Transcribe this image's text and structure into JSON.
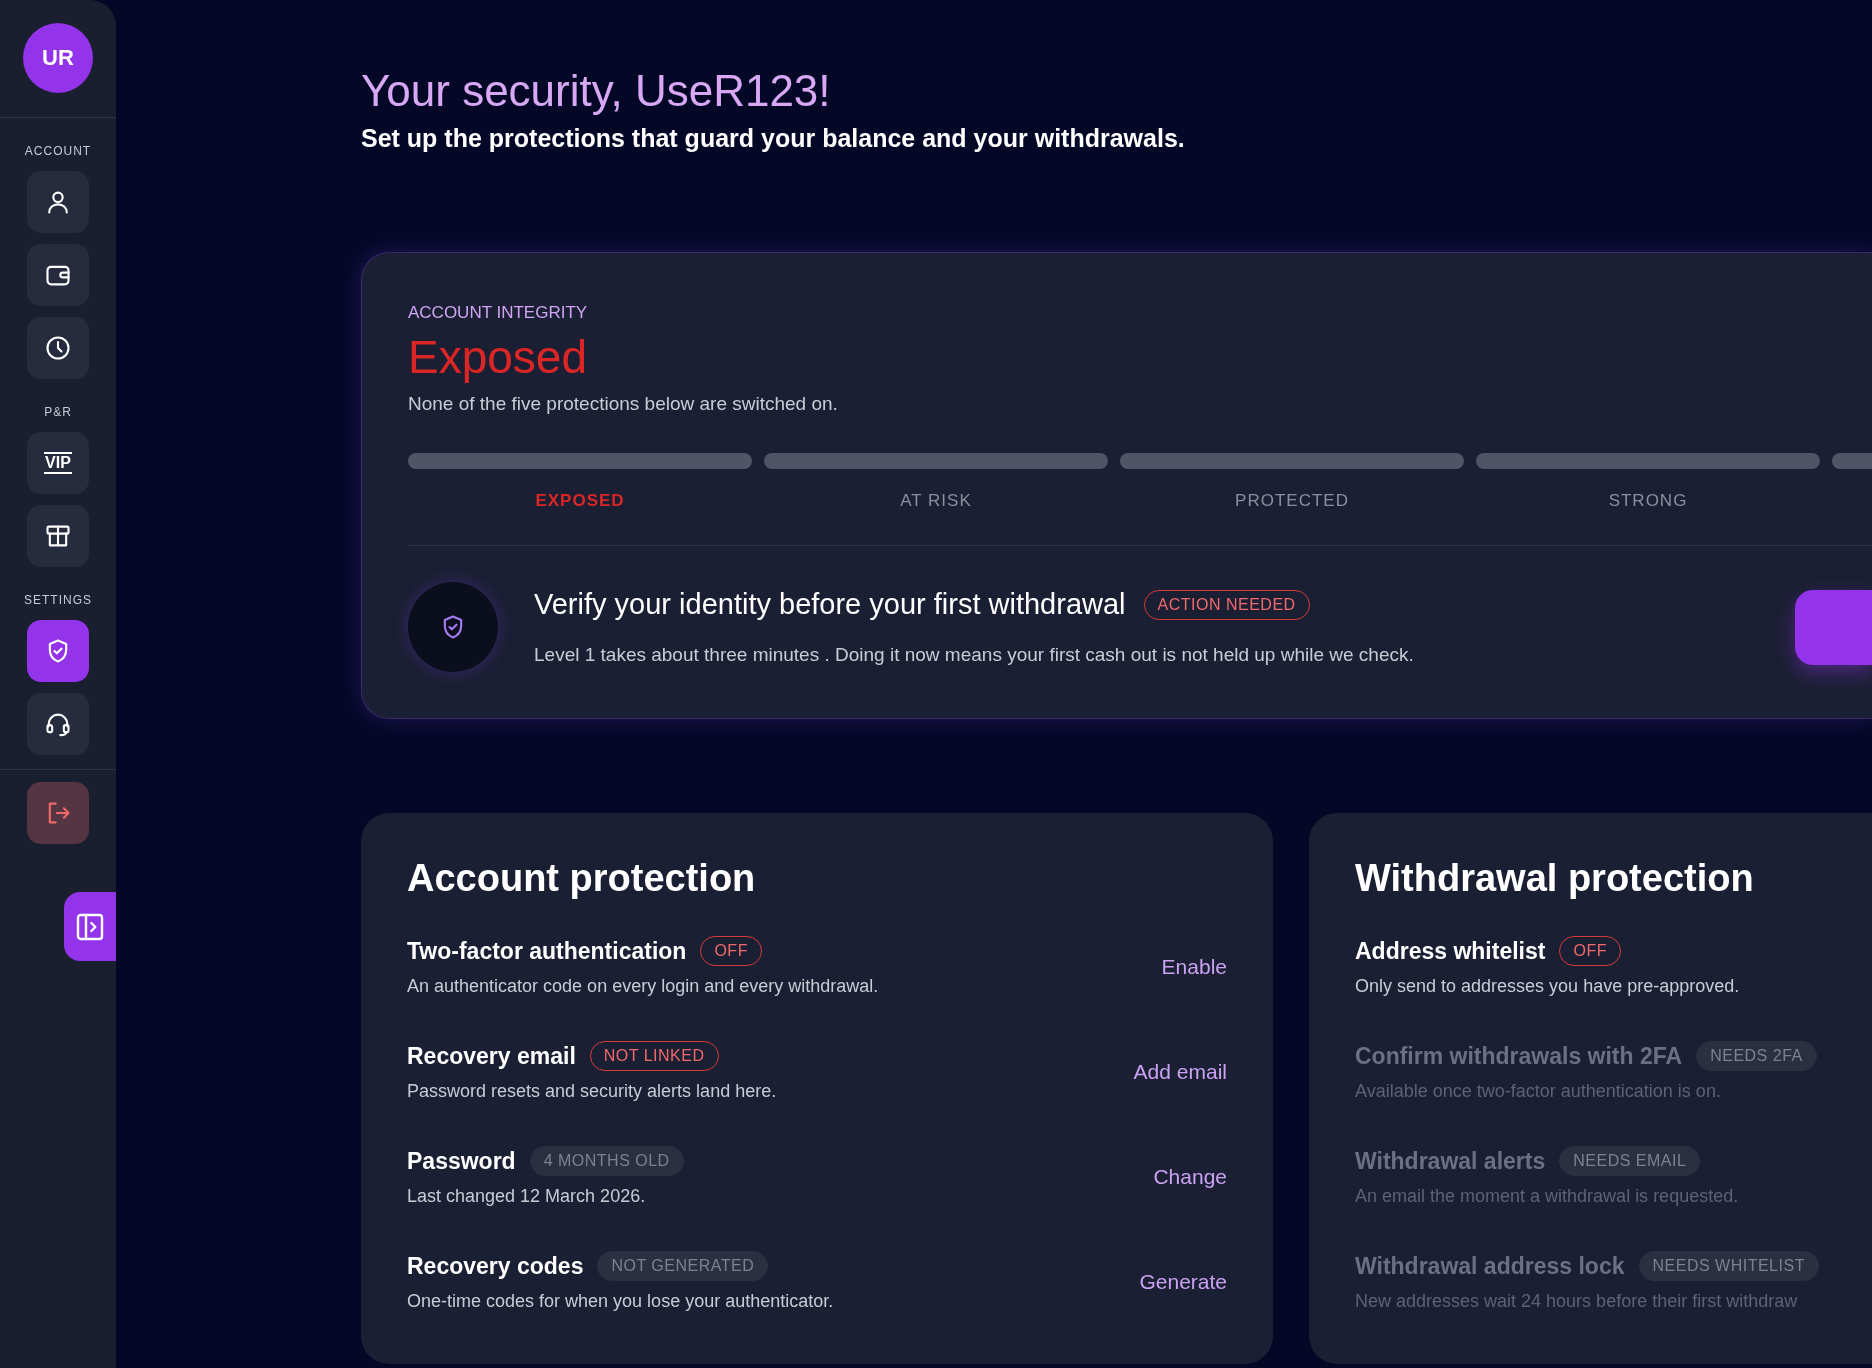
{
  "sidebar": {
    "avatar": "UR",
    "sections": [
      {
        "label": "ACCOUNT",
        "items": [
          {
            "selected": false
          },
          {
            "selected": false
          },
          {
            "selected": false
          }
        ]
      },
      {
        "label": "P&R",
        "items": [
          {
            "text": "VIP",
            "selected": false
          },
          {
            "selected": false
          }
        ]
      },
      {
        "label": "SETTINGS",
        "items": [
          {
            "selected": true
          },
          {
            "selected": false
          }
        ]
      }
    ]
  },
  "header": {
    "title": "Your security, UseR123!",
    "subtitle": "Set up the protections that guard your balance and your withdrawals."
  },
  "integrity": {
    "eyebrow": "ACCOUNT INTEGRITY",
    "status": "Exposed",
    "description": "None of the five protections below are switched on.",
    "segments": [
      {
        "label": "EXPOSED",
        "selected": true
      },
      {
        "label": "AT RISK",
        "selected": false
      },
      {
        "label": "PROTECTED",
        "selected": false
      },
      {
        "label": "STRONG",
        "selected": false
      },
      {
        "selected": false
      }
    ],
    "notice": {
      "title": "Verify your identity before your first withdrawal",
      "badge": "ACTION NEEDED",
      "description": "Level 1 takes about three minutes . Doing it now means your first cash out is not held up while we check."
    }
  },
  "sections": [
    {
      "title": "Account protection",
      "rows": [
        {
          "title": "Two-factor authentication",
          "badge": "OFF",
          "kind": "alert",
          "description": "An authenticator code on every login and every withdrawal.",
          "action": "Enable",
          "disabled": false
        },
        {
          "title": "Recovery email",
          "badge": "NOT LINKED",
          "kind": "alert",
          "description": "Password resets and security alerts land here.",
          "action": "Add email",
          "disabled": false
        },
        {
          "title": "Password",
          "badge": "4 MONTHS OLD",
          "kind": "muted",
          "description": "Last changed 12 March 2026.",
          "action": "Change",
          "disabled": false
        },
        {
          "title": "Recovery codes",
          "badge": "NOT GENERATED",
          "kind": "muted",
          "description": "One-time codes for when you lose your authenticator.",
          "action": "Generate",
          "disabled": false
        }
      ]
    },
    {
      "title": "Withdrawal protection",
      "rows": [
        {
          "title": "Address whitelist",
          "badge": "OFF",
          "kind": "alert",
          "description": "Only send to addresses you have pre-approved.",
          "disabled": false
        },
        {
          "title": "Confirm withdrawals with 2FA",
          "badge": "NEEDS 2FA",
          "kind": "muted",
          "description": "Available once two-factor authentication is on.",
          "disabled": true
        },
        {
          "title": "Withdrawal alerts",
          "badge": "NEEDS EMAIL",
          "kind": "muted",
          "description": "An email the moment a withdrawal is requested.",
          "disabled": true
        },
        {
          "title": "Withdrawal address lock",
          "badge": "NEEDS WHITELIST",
          "kind": "muted",
          "description": "New addresses wait 24 hours before their first withdraw",
          "disabled": true
        }
      ]
    }
  ]
}
